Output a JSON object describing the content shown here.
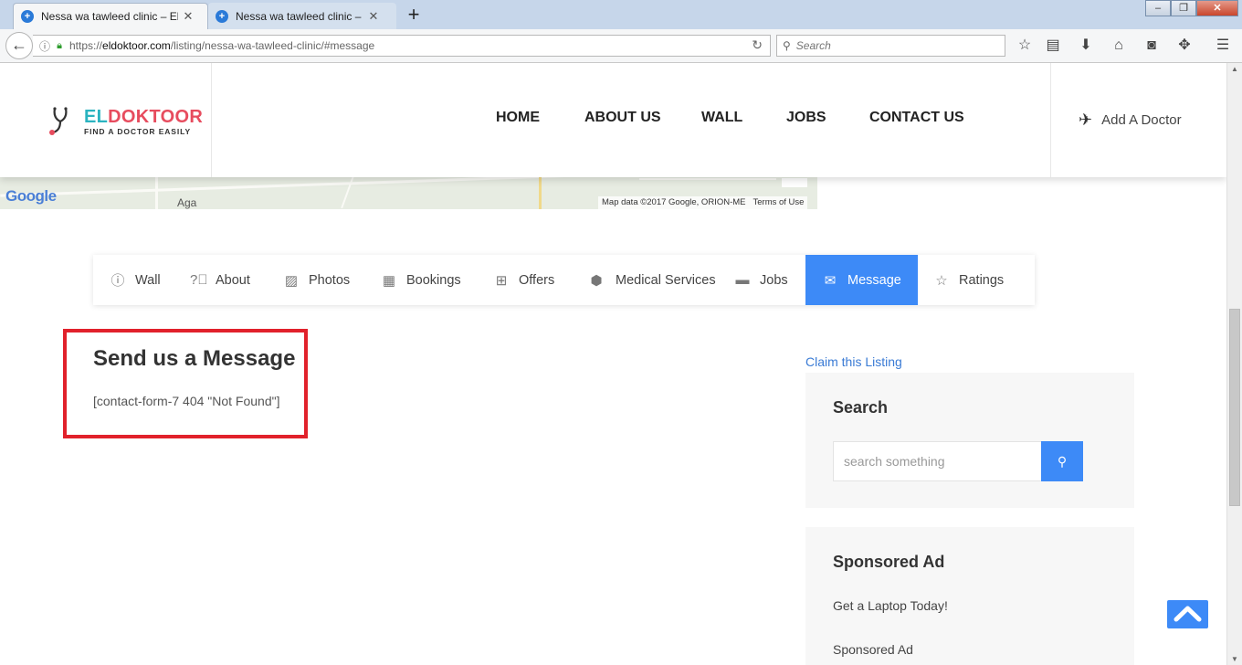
{
  "browser": {
    "tabs": [
      {
        "title": "Nessa wa tawleed clinic – El D",
        "active": true
      },
      {
        "title": "Nessa wa tawleed clinic – El D",
        "active": false
      }
    ],
    "new_tab": "+",
    "url_prefix": "https://",
    "url_domain": "eldoktoor.com",
    "url_path": "/listing/nessa-wa-tawleed-clinic/#message",
    "search_placeholder": "Search"
  },
  "map": {
    "logo": "Google",
    "place_label": "Aga",
    "credits": "Map data ©2017 Google, ORION-ME",
    "terms": "Terms of Use"
  },
  "header": {
    "logo_el": "EL",
    "logo_doktoor": "DOKTOOR",
    "logo_tagline": "FIND A DOCTOR EASILY",
    "nav": [
      "HOME",
      "ABOUT US",
      "WALL",
      "JOBS",
      "CONTACT US"
    ],
    "add_doctor": "Add A Doctor"
  },
  "listing_tabs": [
    {
      "label": "Wall",
      "icon": "info-circle-icon",
      "active": false
    },
    {
      "label": "About",
      "icon": "question-circle-icon",
      "active": false
    },
    {
      "label": "Photos",
      "icon": "image-icon",
      "active": false
    },
    {
      "label": "Bookings",
      "icon": "calendar-icon",
      "active": false
    },
    {
      "label": "Offers",
      "icon": "gift-icon",
      "active": false
    },
    {
      "label": "Medical Services",
      "icon": "cubes-icon",
      "active": false
    },
    {
      "label": "Jobs",
      "icon": "briefcase-icon",
      "active": false
    },
    {
      "label": "Message",
      "icon": "envelope-icon",
      "active": true
    },
    {
      "label": "Ratings",
      "icon": "star-icon",
      "active": false
    }
  ],
  "message": {
    "title": "Send us a Message",
    "error": "[contact-form-7 404 \"Not Found\"]"
  },
  "sidebar": {
    "claim": "Claim this Listing",
    "search_title": "Search",
    "search_placeholder": "search something",
    "ad_title": "Sponsored Ad",
    "ad_link1": "Get a Laptop Today!",
    "ad_link2": "Sponsored Ad"
  },
  "colors": {
    "accent": "#3d8af7",
    "highlight_border": "#e1212b",
    "logo_teal": "#2bb3c0",
    "logo_red": "#e74c5e"
  }
}
